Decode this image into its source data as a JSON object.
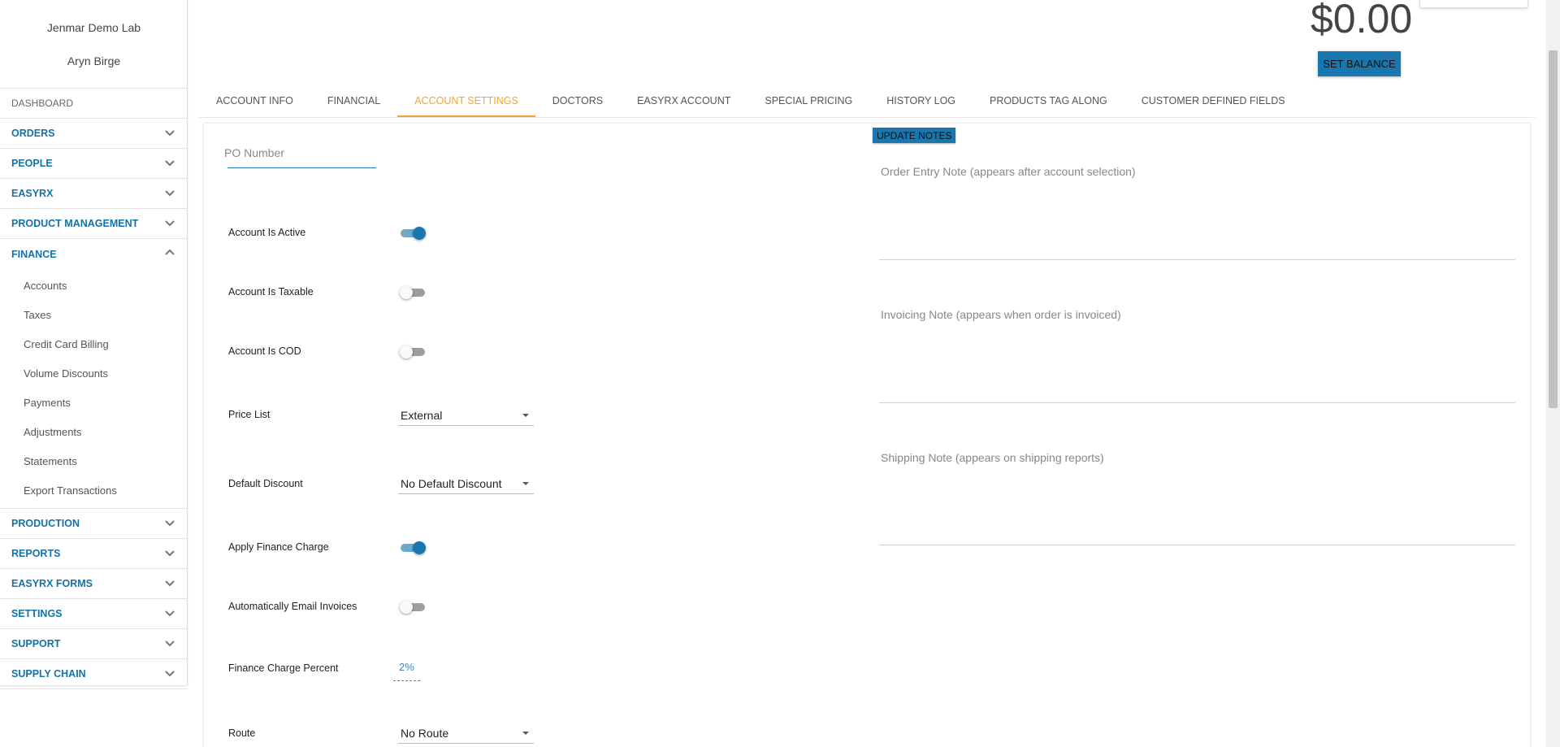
{
  "sidebar": {
    "lab_name": "Jenmar Demo Lab",
    "user_name": "Aryn Birge",
    "dashboard": "DASHBOARD",
    "items": [
      {
        "label": "ORDERS"
      },
      {
        "label": "PEOPLE"
      },
      {
        "label": "EASYRX"
      },
      {
        "label": "PRODUCT MANAGEMENT"
      },
      {
        "label": "FINANCE",
        "expanded": true
      },
      {
        "label": "PRODUCTION"
      },
      {
        "label": "REPORTS"
      },
      {
        "label": "EASYRX FORMS"
      },
      {
        "label": "SETTINGS"
      },
      {
        "label": "SUPPORT"
      },
      {
        "label": "SUPPLY CHAIN"
      }
    ],
    "finance_sub": [
      "Accounts",
      "Taxes",
      "Credit Card Billing",
      "Volume Discounts",
      "Payments",
      "Adjustments",
      "Statements",
      "Export Transactions"
    ]
  },
  "header": {
    "balance": "$0.00",
    "set_balance_label": "SET BALANCE"
  },
  "tabs": [
    {
      "label": "ACCOUNT INFO"
    },
    {
      "label": "FINANCIAL"
    },
    {
      "label": "ACCOUNT SETTINGS",
      "active": true
    },
    {
      "label": "DOCTORS"
    },
    {
      "label": "EASYRX ACCOUNT"
    },
    {
      "label": "SPECIAL PRICING"
    },
    {
      "label": "HISTORY LOG"
    },
    {
      "label": "PRODUCTS TAG ALONG"
    },
    {
      "label": "CUSTOMER DEFINED FIELDS"
    }
  ],
  "settings": {
    "po_number_placeholder": "PO Number",
    "account_active": {
      "label": "Account Is Active",
      "on": true
    },
    "account_taxable": {
      "label": "Account Is Taxable",
      "on": false
    },
    "account_cod": {
      "label": "Account Is COD",
      "on": false
    },
    "price_list": {
      "label": "Price List",
      "value": "External"
    },
    "default_discount": {
      "label": "Default Discount",
      "value": "No Default Discount"
    },
    "apply_finance_charge": {
      "label": "Apply Finance Charge",
      "on": true
    },
    "auto_email_invoices": {
      "label": "Automatically Email Invoices",
      "on": false
    },
    "finance_charge_percent": {
      "label": "Finance Charge Percent",
      "value": "2%"
    },
    "route": {
      "label": "Route",
      "value": "No Route"
    }
  },
  "notes": {
    "update_label": "UPDATE NOTES",
    "order_entry": "Order Entry Note (appears after account selection)",
    "invoicing": "Invoicing Note (appears when order is invoiced)",
    "shipping": "Shipping Note (appears on shipping reports)"
  },
  "colors": {
    "primary": "#1877ae",
    "nav_text": "#1472a8",
    "active_tab": "#f7a133"
  }
}
